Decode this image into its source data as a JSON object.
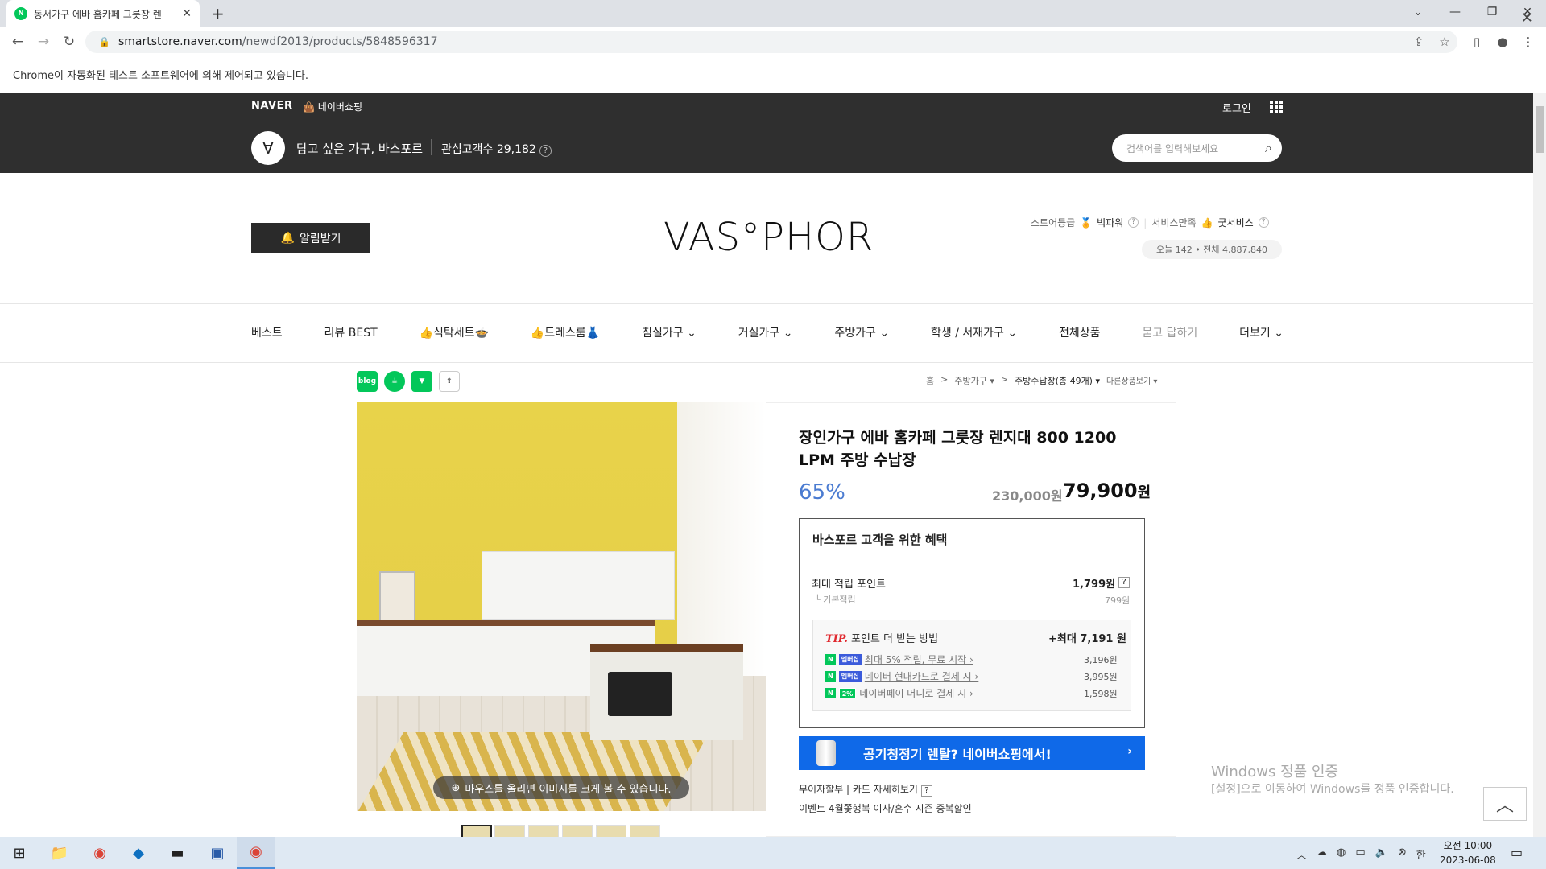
{
  "browser": {
    "tab_title": "동서가구 에바 홈카페 그릇장 렌",
    "url_host": "smartstore.naver.com",
    "url_path": "/newdf2013/products/5848596317",
    "infobar_text": "Chrome이 자동화된 테스트 소프트웨어에 의해 제어되고 있습니다."
  },
  "store_header": {
    "naver": "NAVER",
    "naver_shopping": "네이버쇼핑",
    "login": "로그인",
    "store_name": "담고 싶은 가구, 바스포르",
    "fans_label": "관심고객수 29,182",
    "search_placeholder": "검색어를 입력해보세요"
  },
  "brand": {
    "alarm_button": "알림받기",
    "logo_text": "VAS°PHOR",
    "store_grade_label": "스토어등급",
    "store_grade_value": "빅파워",
    "service_label": "서비스만족",
    "service_value": "굿서비스",
    "visits": "오늘 142 • 전체 4,887,840"
  },
  "menu": [
    "베스트",
    "리뷰 BEST",
    "👍식탁세트🍲",
    "👍드레스룸👗",
    "침실가구 ⌄",
    "거실가구 ⌄",
    "주방가구 ⌄",
    "학생 / 서재가구 ⌄",
    "전체상품",
    "묻고 답하기",
    "더보기 ⌄"
  ],
  "breadcrumb": [
    "홈",
    ">",
    "주방가구 ▾",
    ">",
    "주방수납장(총 49개) ▾",
    "다른상품보기 ▾"
  ],
  "product": {
    "title": "장인가구 에바 홈카페 그릇장 렌지대 800 1200 LPM 주방 수납장",
    "discount": "65%",
    "original_price": "230,000원",
    "price": "79,900",
    "price_unit": "원",
    "zoom_hint": "마우스를 올리면 이미지를 크게 볼 수 있습니다."
  },
  "benefits": {
    "title": "바스포르 고객을 위한 혜택",
    "max_points_label": "최대 적립 포인트",
    "max_points_value": "1,799원",
    "basic_label": "기본적립",
    "basic_value": "799원",
    "tip_label": "TIP.",
    "tip_text": "포인트 더 받는 방법",
    "tip_max": "+최대 7,191 원",
    "tips": [
      {
        "text": "최대 5% 적립, 무료 시작 ›",
        "value": "3,196원"
      },
      {
        "text": "네이버 현대카드로 결제 시 ›",
        "value": "3,995원"
      },
      {
        "text": "네이버페이 머니로 결제 시 ›",
        "value": "1,598원"
      }
    ],
    "badge_membership": "멤버십",
    "badge_pct": "2%"
  },
  "promo_banner": "공기청정기 렌탈? 네이버쇼핑에서!",
  "installment": "무이자할부 | 카드 자세히보기",
  "event": "이벤트    4월쫓행복 이사/혼수 시즌 중복할인",
  "windows": {
    "activation_title": "Windows 정품 인증",
    "activation_sub": "[설정]으로 이동하여 Windows를 정품 인증합니다.",
    "time": "오전 10:00",
    "date": "2023-06-08",
    "ime": "한"
  }
}
